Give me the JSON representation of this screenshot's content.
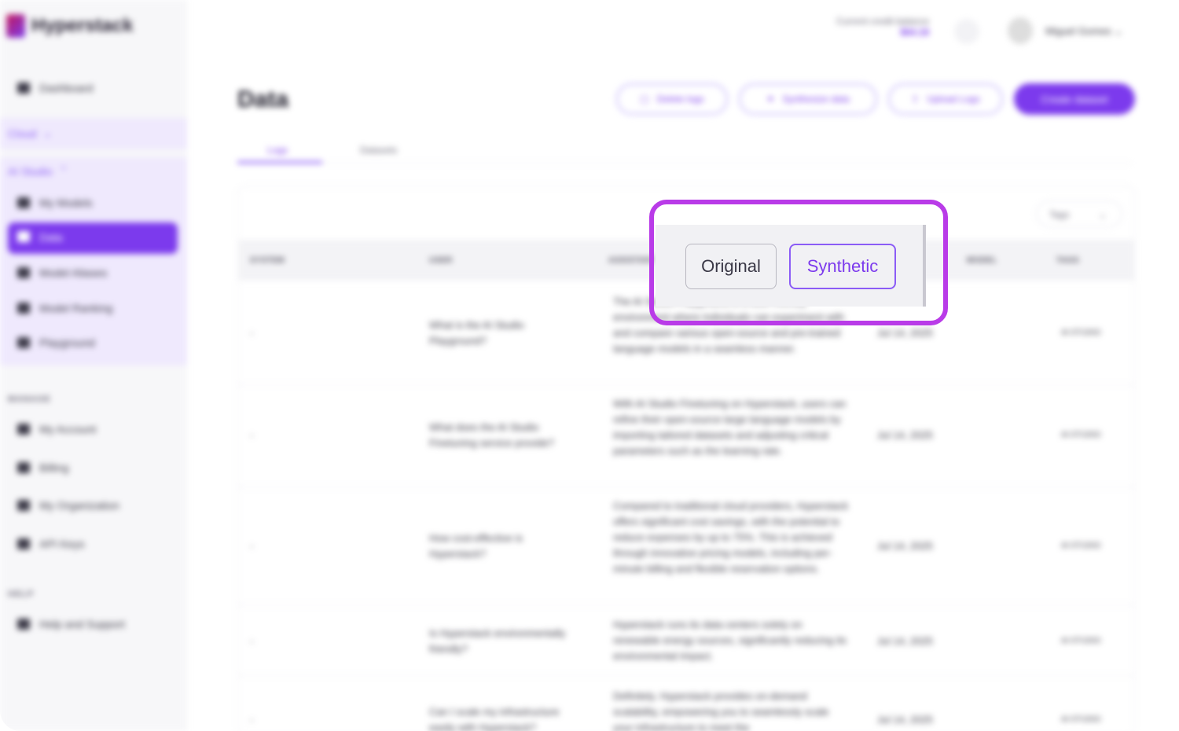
{
  "app": {
    "name": "Hyperstack"
  },
  "header": {
    "credit_label": "Current credit balance",
    "credit_value": "$64.18",
    "user_name": "Miguel Gomes"
  },
  "sidebar": {
    "dashboard": "Dashboard",
    "cloud": "Cloud",
    "ai_studio": "AI Studio",
    "my_models": "My Models",
    "data": "Data",
    "model_aliases": "Model Aliases",
    "model_ranking": "Model Ranking",
    "playground": "Playground",
    "manage_caption": "MANAGE",
    "my_account": "My Account",
    "billing": "Billing",
    "my_organization": "My Organization",
    "api_keys": "API Keys",
    "help_caption": "HELP",
    "help_support": "Help and Support"
  },
  "page": {
    "title": "Data",
    "buttons": {
      "delete_logs": "Delete logs",
      "synthesize": "Synthesize data",
      "upload": "Upload Logs",
      "create": "Create dataset"
    },
    "tabs": [
      "Logs",
      "Datasets"
    ],
    "tags_label": "Tags"
  },
  "table": {
    "headers": [
      "SYSTEM",
      "USER",
      "ASSISTANT",
      "MODEL",
      "TAGS"
    ],
    "rows": [
      {
        "system": "-",
        "user": "What is the AI Studio Playground?",
        "assistant": "The AI Studio Playground is a user-friendly environment where individuals can experiment with and compare various open-source and pre-trained language models in a seamless manner.",
        "date": "Jul 14, 2025",
        "tag": "AI-STUDIO"
      },
      {
        "system": "-",
        "user": "What does the AI Studio Finetuning service provide?",
        "assistant": "With AI Studio Finetuning on Hyperstack, users can refine their open-source large language models by importing tailored datasets and adjusting critical parameters such as the learning rate.",
        "date": "Jul 14, 2025",
        "tag": "AI-STUDIO"
      },
      {
        "system": "-",
        "user": "How cost-effective is Hyperstack?",
        "assistant": "Compared to traditional cloud providers, Hyperstack offers significant cost savings, with the potential to reduce expenses by up to 75%. This is achieved through innovative pricing models, including per-minute billing and flexible reservation options.",
        "date": "Jul 14, 2025",
        "tag": "AI-STUDIO"
      },
      {
        "system": "-",
        "user": "Is Hyperstack environmentally friendly?",
        "assistant": "Hyperstack runs its data centers solely on renewable energy sources, significantly reducing its environmental impact.",
        "date": "Jul 14, 2025",
        "tag": "AI-STUDIO"
      },
      {
        "system": "-",
        "user": "Can I scale my infrastructure easily with Hyperstack?",
        "assistant": "Definitely. Hyperstack provides on-demand scalability, empowering you to seamlessly scale your infrastructure to meet the",
        "date": "Jul 14, 2025",
        "tag": "AI-STUDIO"
      }
    ]
  },
  "popup": {
    "original_label": "Original",
    "synthetic_label": "Synthetic",
    "highlight_color": "#b93be8",
    "accent_color": "#7c3aed"
  }
}
